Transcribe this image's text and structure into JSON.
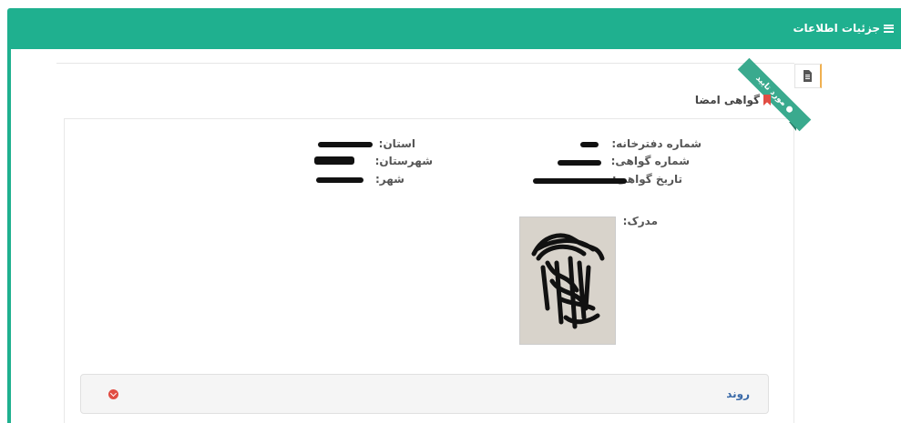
{
  "header": {
    "title": "جزئیات اطلاعات",
    "menu_icon": "bars-icon"
  },
  "document_tab": {
    "icon": "file-text-icon"
  },
  "ribbon": {
    "status": "مورد تایید",
    "icon": "check-circle-icon",
    "color": "#3aaa8e"
  },
  "section": {
    "title": "گواهی امضا",
    "icon": "bookmark-icon"
  },
  "fields": {
    "office_number_label": "شماره دفترخانه:",
    "certificate_number_label": "شماره گواهی:",
    "certificate_date_label": "تاریخ گواهی:",
    "province_label": "استان:",
    "county_label": "شهرستان:",
    "city_label": "شهر:",
    "document_label": "مدرک:"
  },
  "process": {
    "label": "روند",
    "icon": "chevron-down-circle-icon"
  },
  "colors": {
    "primary": "#1fb08f",
    "accent_red": "#e14d43",
    "link_blue": "#3a6aa8"
  }
}
